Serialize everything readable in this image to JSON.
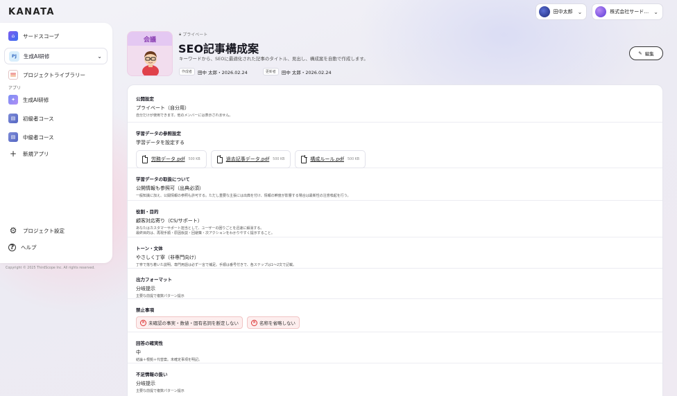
{
  "app": {
    "logo": "KANATA"
  },
  "topbar": {
    "user_name": "田中太郎",
    "org_name": "株式会社サード…"
  },
  "sidebar": {
    "home_label": "サードスコープ",
    "project_badge": "PJ",
    "project_name": "生成AI研修",
    "library_label": "プロジェクトライブラリー",
    "apps_section": "アプリ",
    "apps": [
      {
        "label": "生成AI研修",
        "icon": "app-icon"
      },
      {
        "label": "初級者コース",
        "icon": "book-icon"
      },
      {
        "label": "中級者コース",
        "icon": "book-icon"
      }
    ],
    "new_app_label": "新規アプリ",
    "settings_label": "プロジェクト設定",
    "help_label": "ヘルプ"
  },
  "copyright": "Copyright © 2025 ThirdScope Inc. All rights reserved.",
  "header": {
    "thumb_tag": "会議",
    "visibility": "プライベート",
    "title": "SEO記事構成案",
    "description": "キーワードから、SEOに最適化された記事のタイトル、見出し、構成案を自動で作成します。",
    "created_label": "作成者",
    "created_value": "田中 太郎・2026.02.24",
    "updated_label": "更新者",
    "updated_value": "田中 太郎・2026.02.24",
    "edit_label": "編集"
  },
  "sections": {
    "public": {
      "heading": "公開設定",
      "value": "プライベート（自分用）",
      "note": "自分だけが使用できます。他のメンバーには表示されません。"
    },
    "ref": {
      "heading": "学習データの参照設定",
      "value": "学習データを設定する",
      "files": [
        {
          "name": "労務データ.pdf",
          "size": "500 KB"
        },
        {
          "name": "過去記事データ.pdf",
          "size": "500 KB"
        },
        {
          "name": "構成ルール.pdf",
          "size": "500 KB"
        }
      ]
    },
    "handling": {
      "heading": "学習データの取扱について",
      "value": "公開情報も参照可（出典必須）",
      "note": "一般知識に加え、公開情報の参照も許可する。ただし重要な主張には出典を付け、情報の鮮度が影響する場合は最新性の注意喚起を行う。"
    },
    "role": {
      "heading": "役割・目的",
      "value": "顧客対応寄り（CS/サポート）",
      "note1": "あなたはカスタマーサポート担当として、ユーザーの困りごとを迅速に解消する。",
      "note2": "最終目的は、再現手順・原因仮説・回避策・次アクションをわかりやすく提示すること。"
    },
    "tone": {
      "heading": "トーン・文体",
      "value": "やさしく丁寧（非専門向け）",
      "note": "丁寧で落ち着いた説明。専門用語は必ず一言で補足。手順は番号付きで、各ステップは1〜2文で記載。"
    },
    "format": {
      "heading": "出力フォーマット",
      "value": "分岐提示",
      "note": "主要な前提で複数パターン提示"
    },
    "prohibited": {
      "heading": "禁止事項",
      "chips": [
        "未確認の事実・数値・固有名詞を断定しない",
        "名称を省略しない"
      ]
    },
    "certainty": {
      "heading": "回答の確実性",
      "value": "中",
      "note": "結論＋根拠＋代替案。未確定事項を明記。"
    },
    "missing": {
      "heading": "不足情報の扱い",
      "value": "分岐提示",
      "note": "主要な前提で複数パターン提示"
    }
  }
}
